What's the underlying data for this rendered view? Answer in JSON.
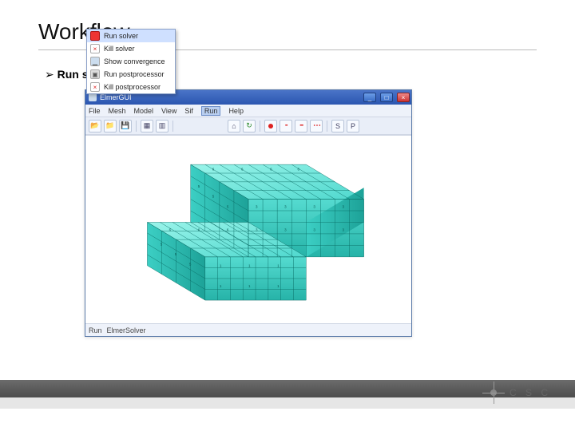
{
  "slide": {
    "title": "Workflow",
    "bullet": "Run solver:"
  },
  "app": {
    "title": "ElmerGUI",
    "menu": [
      "File",
      "Mesh",
      "Model",
      "View",
      "Sif",
      "Run",
      "Help"
    ],
    "menu_active_index": 5,
    "dropdown": [
      {
        "label": "Run solver",
        "highlight": true
      },
      {
        "label": "Kill solver"
      },
      {
        "label": "Show convergence"
      },
      {
        "label": "Run postprocessor"
      },
      {
        "label": "Kill postprocessor"
      }
    ],
    "status_prefix": "Run",
    "status_file": "ElmerSolver"
  },
  "logo": {
    "text": "C S C"
  }
}
